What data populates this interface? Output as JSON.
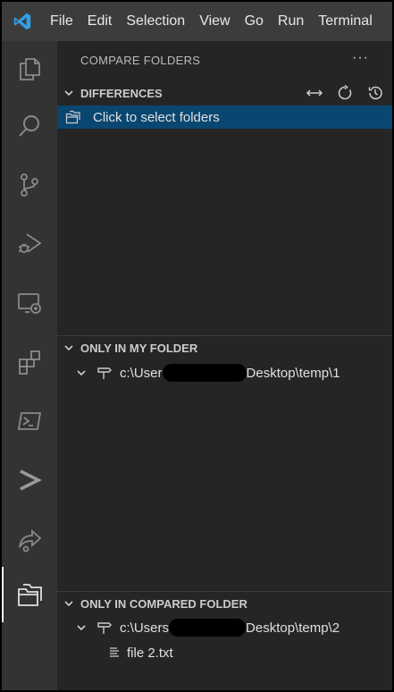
{
  "menubar": {
    "logo_icon": "vscode-logo-icon",
    "items": [
      "File",
      "Edit",
      "Selection",
      "View",
      "Go",
      "Run",
      "Terminal"
    ]
  },
  "activity_bar": {
    "icons": [
      "explorer-icon",
      "search-icon",
      "source-control-icon",
      "run-debug-icon",
      "remote-explorer-icon",
      "extensions-icon",
      "powershell-icon",
      "terminal-prompt-icon",
      "live-share-icon",
      "compare-folders-icon"
    ],
    "active": "compare-folders-icon"
  },
  "sidebar": {
    "title": "COMPARE FOLDERS",
    "more": "···",
    "differences": {
      "header": "DIFFERENCES",
      "actions": [
        "swap-icon",
        "refresh-icon",
        "history-icon"
      ],
      "items": [
        {
          "label": "Click to select folders",
          "selected": true
        }
      ]
    },
    "only_in_my_folder": {
      "header": "ONLY IN MY FOLDER",
      "path_start": "c:\\User",
      "path_end": "Desktop\\temp\\1"
    },
    "only_in_compared_folder": {
      "header": "ONLY IN COMPARED FOLDER",
      "path_start": "c:\\Users",
      "path_end": "Desktop\\temp\\2",
      "files": [
        "file 2.txt"
      ]
    }
  },
  "colors": {
    "menubar_bg": "#3c3c3c",
    "activity_bg": "#333333",
    "sidebar_bg": "#252526",
    "selection_bg": "#094771",
    "accent_blue": "#2f9fe8"
  }
}
